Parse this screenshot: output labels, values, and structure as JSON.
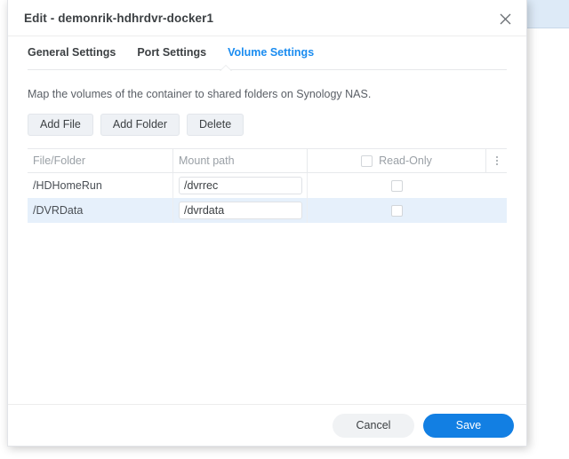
{
  "backdrop": {
    "accent_strip_color": "#ddeaf7"
  },
  "dialog": {
    "title": "Edit - demonrik-hdhrdvr-docker1",
    "close_icon": "close-icon",
    "tabs": [
      {
        "label": "General Settings",
        "active": false
      },
      {
        "label": "Port Settings",
        "active": false
      },
      {
        "label": "Volume Settings",
        "active": true
      }
    ],
    "description": "Map the volumes of the container to shared folders on Synology NAS.",
    "action_buttons": [
      {
        "label": "Add File",
        "name": "add-file-button"
      },
      {
        "label": "Add Folder",
        "name": "add-folder-button"
      },
      {
        "label": "Delete",
        "name": "delete-button"
      }
    ],
    "table": {
      "columns": [
        "File/Folder",
        "Mount path",
        "Read-Only"
      ],
      "header_checkbox_checked": false,
      "column_menu_icon": "kebab-menu-icon",
      "rows": [
        {
          "file_folder": "/HDHomeRun",
          "mount_path": "/dvrrec",
          "read_only": false,
          "selected": false
        },
        {
          "file_folder": "/DVRData",
          "mount_path": "/dvrdata",
          "read_only": false,
          "selected": true
        }
      ]
    },
    "footer": {
      "cancel_label": "Cancel",
      "save_label": "Save",
      "save_color": "#127fe3"
    }
  }
}
